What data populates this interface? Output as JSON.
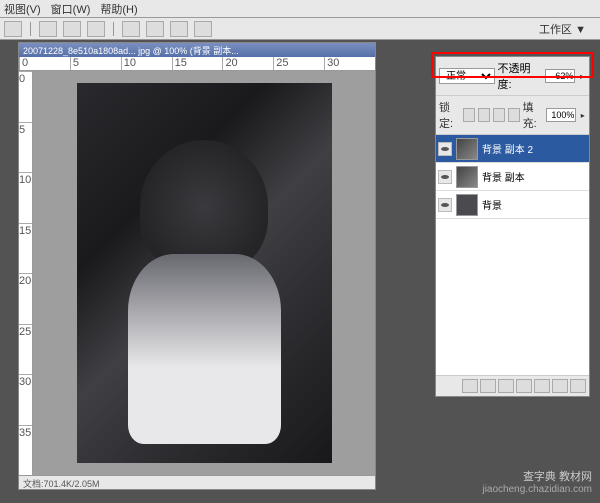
{
  "menu": {
    "items": [
      "视图(V)",
      "窗口(W)",
      "帮助(H)"
    ]
  },
  "toolbar": {
    "workarea_label": "工作区 ▼"
  },
  "document": {
    "title": "20071228_8e510a1808ad... jpg @ 100% (背景 副本...",
    "ruler_h": [
      "0",
      "5",
      "10",
      "15",
      "20",
      "25",
      "30"
    ],
    "ruler_v": [
      "0",
      "5",
      "10",
      "15",
      "20",
      "25",
      "30",
      "35"
    ],
    "status": "文档:701.4K/2.05M"
  },
  "layers": {
    "blend_mode": "正常",
    "opacity_label": "不透明度:",
    "opacity_value": "62%",
    "lock_label": "锁定:",
    "fill_label": "填充:",
    "fill_value": "100%",
    "items": [
      {
        "name": "背景 副本 2",
        "selected": true
      },
      {
        "name": "背景 副本",
        "selected": false
      },
      {
        "name": "背景",
        "selected": false
      }
    ]
  },
  "watermark": {
    "main": "查字典 教材网",
    "sub": "jiaocheng.chazidian.com"
  }
}
